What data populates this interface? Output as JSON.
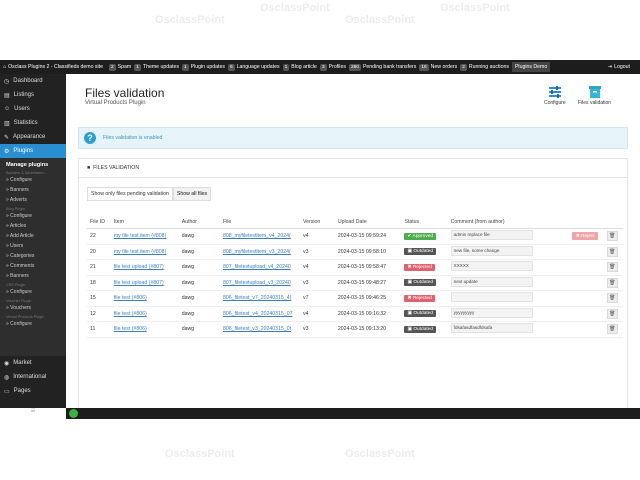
{
  "watermark": "OsclassPoint",
  "topbar": {
    "site_title": "Osclass Plugins 2 - Classifieds demo site",
    "items": [
      {
        "count": "2",
        "label": "Spam"
      },
      {
        "count": "1",
        "label": "Theme updates"
      },
      {
        "count": "1",
        "label": "Plugin updates"
      },
      {
        "count": "6",
        "label": "Language updates"
      },
      {
        "count": "1",
        "label": "Blog article"
      },
      {
        "count": "3",
        "label": "Profiles"
      },
      {
        "count": "260",
        "label": "Pending bank transfers"
      },
      {
        "count": "16",
        "label": "New orders"
      },
      {
        "count": "2",
        "label": "Running auctions"
      }
    ],
    "demo_label": "Plugins Demo",
    "logout_label": "Logout"
  },
  "sidebar": {
    "top_items": [
      "Dashboard",
      "Listings",
      "Users",
      "Statistics",
      "Appearance"
    ],
    "active_item": "Plugins",
    "submenu": {
      "heading": "Manage plugins",
      "groups": [
        {
          "group": "Banners & Advertisem...",
          "links": [
            "Configure",
            "Banners",
            "Adverts"
          ]
        },
        {
          "group": "Blog Plugin",
          "links": [
            "Configure",
            "Articles",
            "Add Article",
            "Users",
            "Categories",
            "Comments",
            "Banners"
          ]
        },
        {
          "group": "CSS Plugin",
          "links": [
            "Configure"
          ]
        },
        {
          "group": "Voucher Plugin",
          "links": [
            "Vouchers"
          ]
        },
        {
          "group": "Virtual Products Plugin",
          "links": [
            "Configure"
          ]
        }
      ]
    },
    "bottom_items": [
      "Market",
      "International",
      "Pages"
    ],
    "collapse_icon": "≡"
  },
  "page": {
    "title": "Files validation",
    "subtitle": "Virtual Products Plugin",
    "configure_label": "Configure",
    "files_validation_label": "Files validation"
  },
  "alert": {
    "text": "Files validation is enabled"
  },
  "panel": {
    "title": "FILES VALIDATION",
    "filter_pending": "Show only files pending validation",
    "filter_all": "Show all files"
  },
  "table": {
    "headers": [
      "File ID",
      "Item",
      "Author",
      "File",
      "Version",
      "Upload Date",
      "Status",
      "Comment (from author)"
    ],
    "rows": [
      {
        "id": "22",
        "item": "my file test item (#808)",
        "author": "dawg",
        "file": "808_myfiletestitem_v4_2024(",
        "version": "v4",
        "date": "2024-03-15 09:59:24",
        "status": "Approved",
        "status_type": "approved",
        "comment": "admin replace file",
        "reject": "Reject"
      },
      {
        "id": "20",
        "item": "my file test item (#808)",
        "author": "dawg",
        "file": "808_myfiletestitem_v3_2024(",
        "version": "v3",
        "date": "2024-03-15 09:58:10",
        "status": "Outdated",
        "status_type": "outdated",
        "comment": "new file, some change",
        "reject": ""
      },
      {
        "id": "21",
        "item": "file test upload (#807)",
        "author": "dawg",
        "file": "807_filetestupload_v4_20240",
        "version": "v4",
        "date": "2024-03-15 09:58:47",
        "status": "Rejected",
        "status_type": "rejected",
        "comment": "XXXXX",
        "reject": ""
      },
      {
        "id": "18",
        "item": "file test upload (#807)",
        "author": "dawg",
        "file": "807_filetestupload_v3_20240",
        "version": "v3",
        "date": "2024-03-15 09:48:27",
        "status": "Outdated",
        "status_type": "outdated",
        "comment": "next update",
        "reject": ""
      },
      {
        "id": "15",
        "item": "file test (#806)",
        "author": "dawg",
        "file": "806_filetest_v7_20240315_4(",
        "version": "v7",
        "date": "2024-03-15 09:46:25",
        "status": "Rejected",
        "status_type": "rejected",
        "comment": "",
        "reject": ""
      },
      {
        "id": "12",
        "item": "file test (#806)",
        "author": "dawg",
        "file": "806_filetest_v4_20240315_07",
        "version": "v4",
        "date": "2024-03-15 09:16:32",
        "status": "Outdated",
        "status_type": "outdated",
        "comment": "yyyyyyyyy",
        "reject": ""
      },
      {
        "id": "11",
        "item": "file test (#806)",
        "author": "dawg",
        "file": "806_filetest_v3_20240315_0t",
        "version": "v3",
        "date": "2024-03-15 09:13:20",
        "status": "Outdated",
        "status_type": "outdated",
        "comment": "fdsafasdfasdfdsafa",
        "reject": ""
      }
    ]
  },
  "colors": {
    "accent": "#2a8fd1",
    "approved": "#4cae4c",
    "rejected": "#e0626e",
    "outdated": "#555555"
  }
}
